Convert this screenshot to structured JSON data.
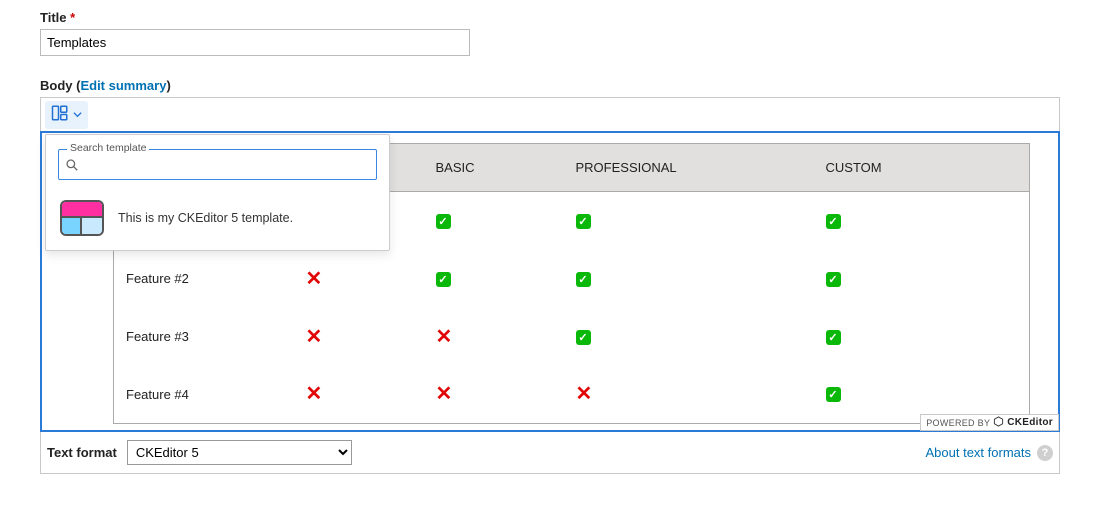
{
  "title_field": {
    "label": "Title",
    "required": "*",
    "value": "Templates"
  },
  "body_field": {
    "label_prefix": "Body (",
    "edit_summary_link": "Edit summary",
    "label_suffix": ")"
  },
  "template_panel": {
    "search_label": "Search template",
    "search_value": "",
    "item_description": "This is my CKEditor 5 template."
  },
  "table": {
    "headers": {
      "feature": "",
      "starter": "",
      "basic": "BASIC",
      "professional": "PROFESSIONAL",
      "custom": "CUSTOM"
    },
    "rows": [
      {
        "label": "",
        "starter": "",
        "basic": "check",
        "professional": "check",
        "custom": "check"
      },
      {
        "label": "Feature #2",
        "starter": "cross",
        "basic": "check",
        "professional": "check",
        "custom": "check"
      },
      {
        "label": "Feature #3",
        "starter": "cross",
        "basic": "cross",
        "professional": "check",
        "custom": "check"
      },
      {
        "label": "Feature #4",
        "starter": "cross",
        "basic": "cross",
        "professional": "cross",
        "custom": "check"
      }
    ]
  },
  "powered": {
    "prefix": "POWERED BY",
    "brand": "CKEditor"
  },
  "footer": {
    "text_format_label": "Text format",
    "text_format_value": "CKEditor 5",
    "about_link": "About text formats"
  }
}
